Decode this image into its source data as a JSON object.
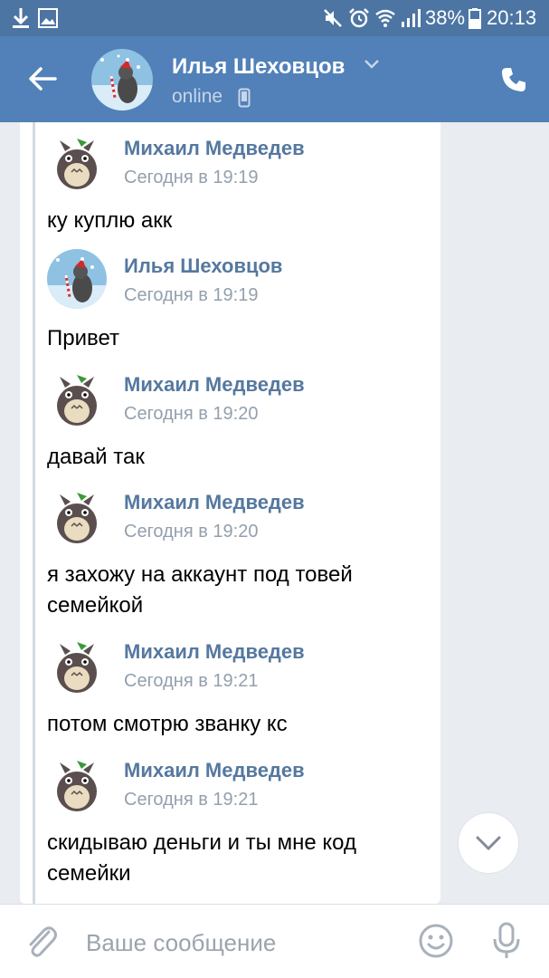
{
  "status_bar": {
    "battery": "38%",
    "time": "20:13"
  },
  "header": {
    "name": "Илья Шеховцов",
    "status": "online"
  },
  "messages": [
    {
      "author": "Михаил Медведев",
      "time": "Сегодня в 19:19",
      "text": "ку куплю акк",
      "avatar": "totoro"
    },
    {
      "author": "Илья Шеховцов",
      "time": "Сегодня в 19:19",
      "text": "Привет",
      "avatar": "cat"
    },
    {
      "author": "Михаил Медведев",
      "time": "Сегодня в 19:20",
      "text": "давай так",
      "avatar": "totoro"
    },
    {
      "author": "Михаил Медведев",
      "time": "Сегодня в 19:20",
      "text": "я захожу на аккаунт под товей семейкой",
      "avatar": "totoro"
    },
    {
      "author": "Михаил Медведев",
      "time": "Сегодня в 19:21",
      "text": "потом смотрю званку кс",
      "avatar": "totoro"
    },
    {
      "author": "Михаил Медведев",
      "time": "Сегодня в 19:21",
      "text": "скидываю деньги и ты мне код семейки",
      "avatar": "totoro"
    }
  ],
  "composer": {
    "placeholder": "Ваше сообщение"
  },
  "icons": {
    "status_left": [
      "download-icon",
      "image-icon"
    ],
    "status_right": [
      "mute-icon",
      "alarm-icon",
      "wifi-icon",
      "signal-icon",
      "battery-icon"
    ],
    "header": [
      "back-arrow-icon",
      "chevron-down-icon",
      "mobile-device-icon",
      "phone-icon"
    ],
    "composer": [
      "paperclip-icon",
      "emoji-icon",
      "microphone-icon"
    ],
    "scroll": "chevron-down-icon"
  },
  "colors": {
    "header": "#5181b8",
    "status_bar": "#4c75a3",
    "author_name": "#55789f",
    "timestamp": "#93a0ad",
    "background": "#e9ecf0"
  }
}
